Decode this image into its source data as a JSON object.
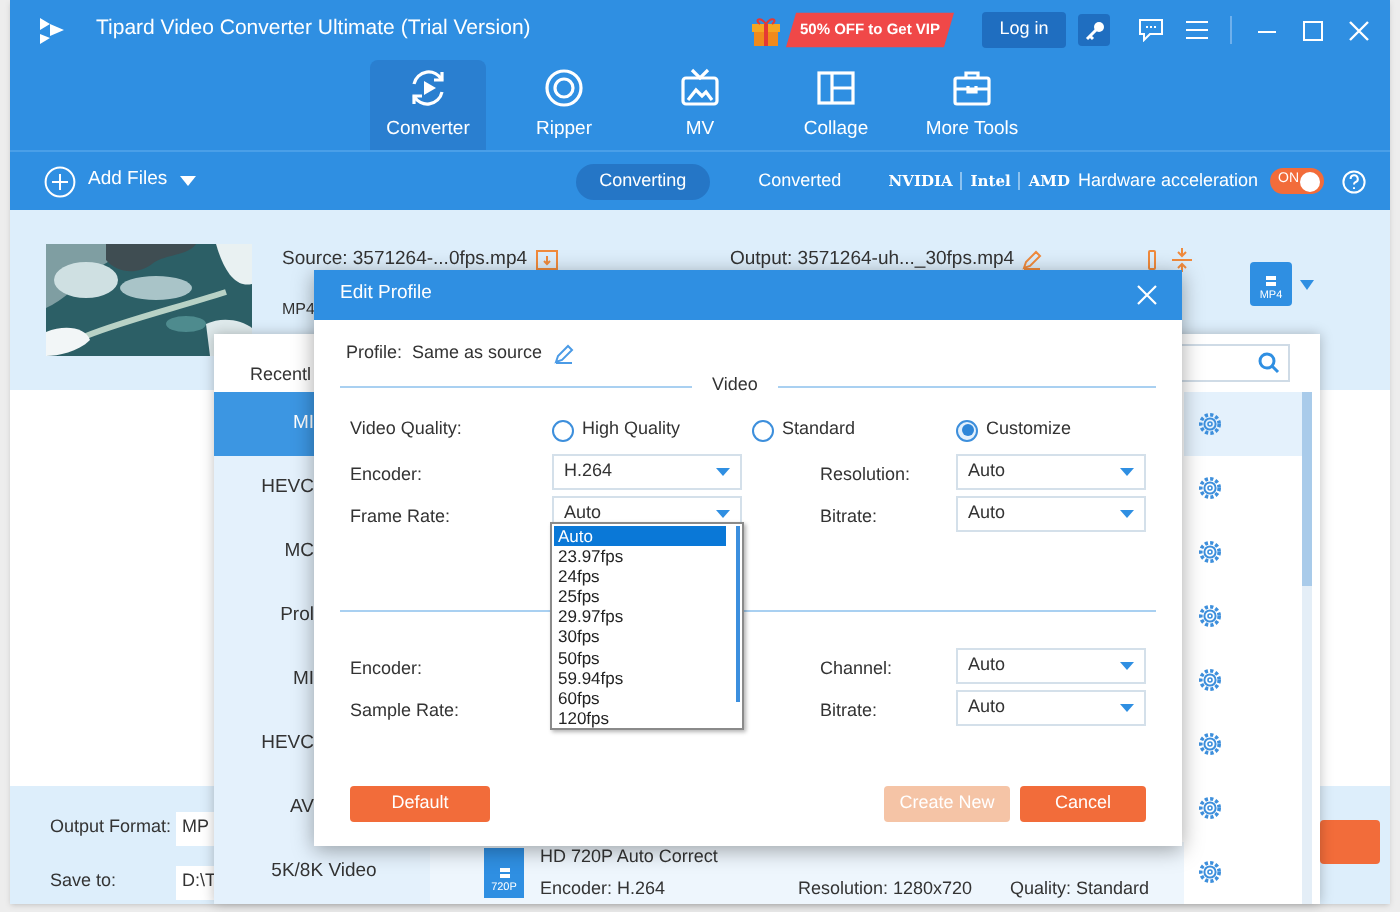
{
  "window": {
    "title": "Tipard Video Converter Ultimate (Trial Version)"
  },
  "title_bar": {
    "promo": "50% OFF to Get VIP",
    "login": "Log in"
  },
  "nav_tabs": [
    {
      "label": "Converter",
      "kind": "converter",
      "selected": true
    },
    {
      "label": "Ripper",
      "kind": "disc",
      "selected": false
    },
    {
      "label": "MV",
      "kind": "tv",
      "selected": false
    },
    {
      "label": "Collage",
      "kind": "collage",
      "selected": false
    },
    {
      "label": "More Tools",
      "kind": "toolbox",
      "selected": false
    }
  ],
  "toolbar": {
    "add_files": "Add Files",
    "tabs": [
      {
        "label": "Converting",
        "selected": true
      },
      {
        "label": "Converted",
        "selected": false
      }
    ],
    "gpu": [
      "NVIDIA",
      "Intel",
      "AMD"
    ],
    "hw_label": "Hardware acceleration",
    "hw_toggle": {
      "label": "ON",
      "on": true
    }
  },
  "file": {
    "source": "Source: 3571264-...0fps.mp4",
    "output": "Output: 3571264-uh..._30fps.mp4",
    "format": "MP4",
    "format_badge": "MP4"
  },
  "bottom_bar": {
    "output_format_label": "Output Format:",
    "output_format_value": "MP",
    "save_to_label": "Save to:",
    "save_to_value": "D:\\T"
  },
  "format_panel": {
    "tab": "Recentl",
    "categories": [
      {
        "label": "MI",
        "selected": true
      },
      {
        "label": "HEVC",
        "selected": false
      },
      {
        "label": "MC",
        "selected": false
      },
      {
        "label": "Prol",
        "selected": false
      },
      {
        "label": "MI",
        "selected": false
      },
      {
        "label": "HEVC",
        "selected": false
      },
      {
        "label": "AV",
        "selected": false
      },
      {
        "label": "5K/8K Video",
        "selected": false
      }
    ],
    "preset": {
      "badge": "720P",
      "name": "HD 720P Auto Correct",
      "encoder": "Encoder: H.264",
      "resolution": "Resolution: 1280x720",
      "quality": "Quality: Standard"
    }
  },
  "dialog": {
    "title": "Edit Profile",
    "profile": "Profile:  Same as source",
    "video_heading": "Video",
    "quality_label": "Video Quality:",
    "quality_options": [
      {
        "label": "High Quality",
        "selected": false
      },
      {
        "label": "Standard",
        "selected": false
      },
      {
        "label": "Customize",
        "selected": true
      }
    ],
    "video_fields": [
      {
        "label": "Encoder:",
        "value": "H.264"
      },
      {
        "label": "Resolution:",
        "value": "Auto"
      },
      {
        "label": "Frame Rate:",
        "value": "Auto"
      },
      {
        "label": "Bitrate:",
        "value": "Auto"
      }
    ],
    "audio_fields": [
      {
        "label": "Encoder:"
      },
      {
        "label": "Channel:",
        "value": "Auto"
      },
      {
        "label": "Sample Rate:"
      },
      {
        "label": "Bitrate:",
        "value": "Auto"
      }
    ],
    "frame_rate_options": [
      {
        "label": "Auto",
        "selected": true
      },
      {
        "label": "23.97fps",
        "selected": false
      },
      {
        "label": "24fps",
        "selected": false
      },
      {
        "label": "25fps",
        "selected": false
      },
      {
        "label": "29.97fps",
        "selected": false
      },
      {
        "label": "30fps",
        "selected": false
      },
      {
        "label": "50fps",
        "selected": false
      },
      {
        "label": "59.94fps",
        "selected": false
      },
      {
        "label": "60fps",
        "selected": false
      },
      {
        "label": "120fps",
        "selected": false
      }
    ],
    "buttons": [
      {
        "label": "Default",
        "disabled": false
      },
      {
        "label": "Create New",
        "disabled": true
      },
      {
        "label": "Cancel",
        "disabled": false
      }
    ]
  }
}
